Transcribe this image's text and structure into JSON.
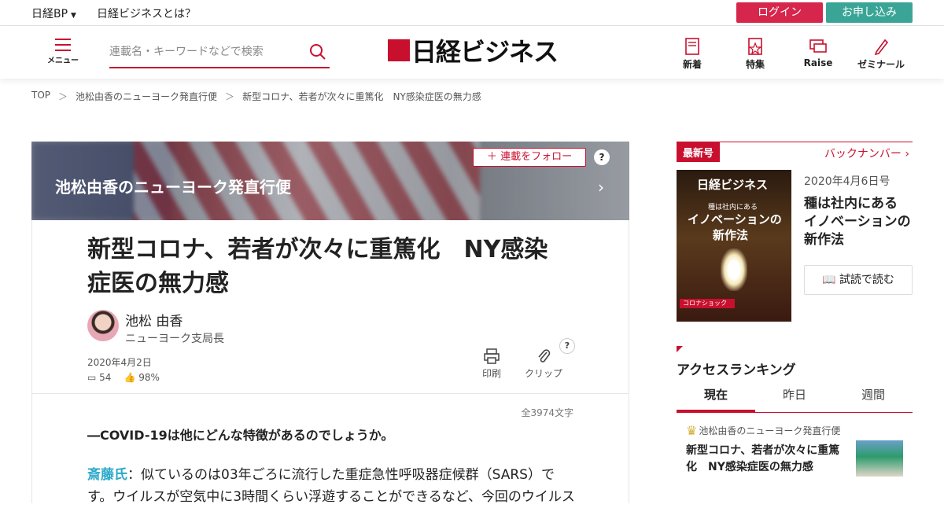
{
  "topbar": {
    "brand": "日経BP",
    "about": "日経ビジネスとは？",
    "login": "ログイン",
    "apply": "お申し込み"
  },
  "header": {
    "menu_label": "メニュー",
    "search_placeholder": "連載名・キーワードなどで検索",
    "logo_text": "日経ビジネス",
    "nav": [
      {
        "label": "新着",
        "icon": "new-doc-icon"
      },
      {
        "label": "特集",
        "icon": "star-doc-icon"
      },
      {
        "label": "Raise",
        "icon": "chat-icon"
      },
      {
        "label": "ゼミナール",
        "icon": "pen-icon"
      }
    ]
  },
  "breadcrumb": {
    "items": [
      "TOP",
      "池松由香のニューヨーク発直行便",
      "新型コロナ、若者が次々に重篤化　NY感染症医の無力感"
    ],
    "separator": "＞"
  },
  "hero": {
    "series": "池松由香のニューヨーク発直行便",
    "follow": "連載をフォロー",
    "help": "?"
  },
  "article": {
    "title": "新型コロナ、若者が次々に重篤化　NY感染症医の無力感",
    "author_name": "池松 由香",
    "author_role": "ニューヨーク支局長",
    "date": "2020年4月2日",
    "comments": "54",
    "likes": "98%",
    "print": "印刷",
    "clip": "クリップ",
    "clip_help": "?",
    "char_count": "全3974文字",
    "question": "―COVID-19は他にどんな特徴があるのでしょうか。",
    "speaker": "斎藤氏",
    "answer_text": "：似ているのは03年ごろに流行した重症急性呼吸器症候群（SARS）です。ウイルスが空気中に3時間くらい浮遊することができるなど、今回のウイルス"
  },
  "sidebar": {
    "latest_tag": "最新号",
    "backnumber": "バックナンバー",
    "cover_logo": "日経ビジネス",
    "cover_sub": "種は社内にある",
    "cover_headline_1": "イノベーションの",
    "cover_headline_2": "新作法",
    "cover_band": "コロナショック",
    "issue_date": "2020年4月6日号",
    "issue_title": "種は社内にある イノベーションの新作法",
    "trial": "試読で読む",
    "ranking_title": "アクセスランキング",
    "tabs": [
      "現在",
      "昨日",
      "週間"
    ],
    "rank1_series": "池松由香のニューヨーク発直行便",
    "rank1_title": "新型コロナ、若者が次々に重篤化　NY感染症医の無力感"
  },
  "colors": {
    "brand_red": "#c8102e",
    "login_red": "#d6264c",
    "apply_green": "#3aa596",
    "link_blue": "#2aa8c9"
  }
}
